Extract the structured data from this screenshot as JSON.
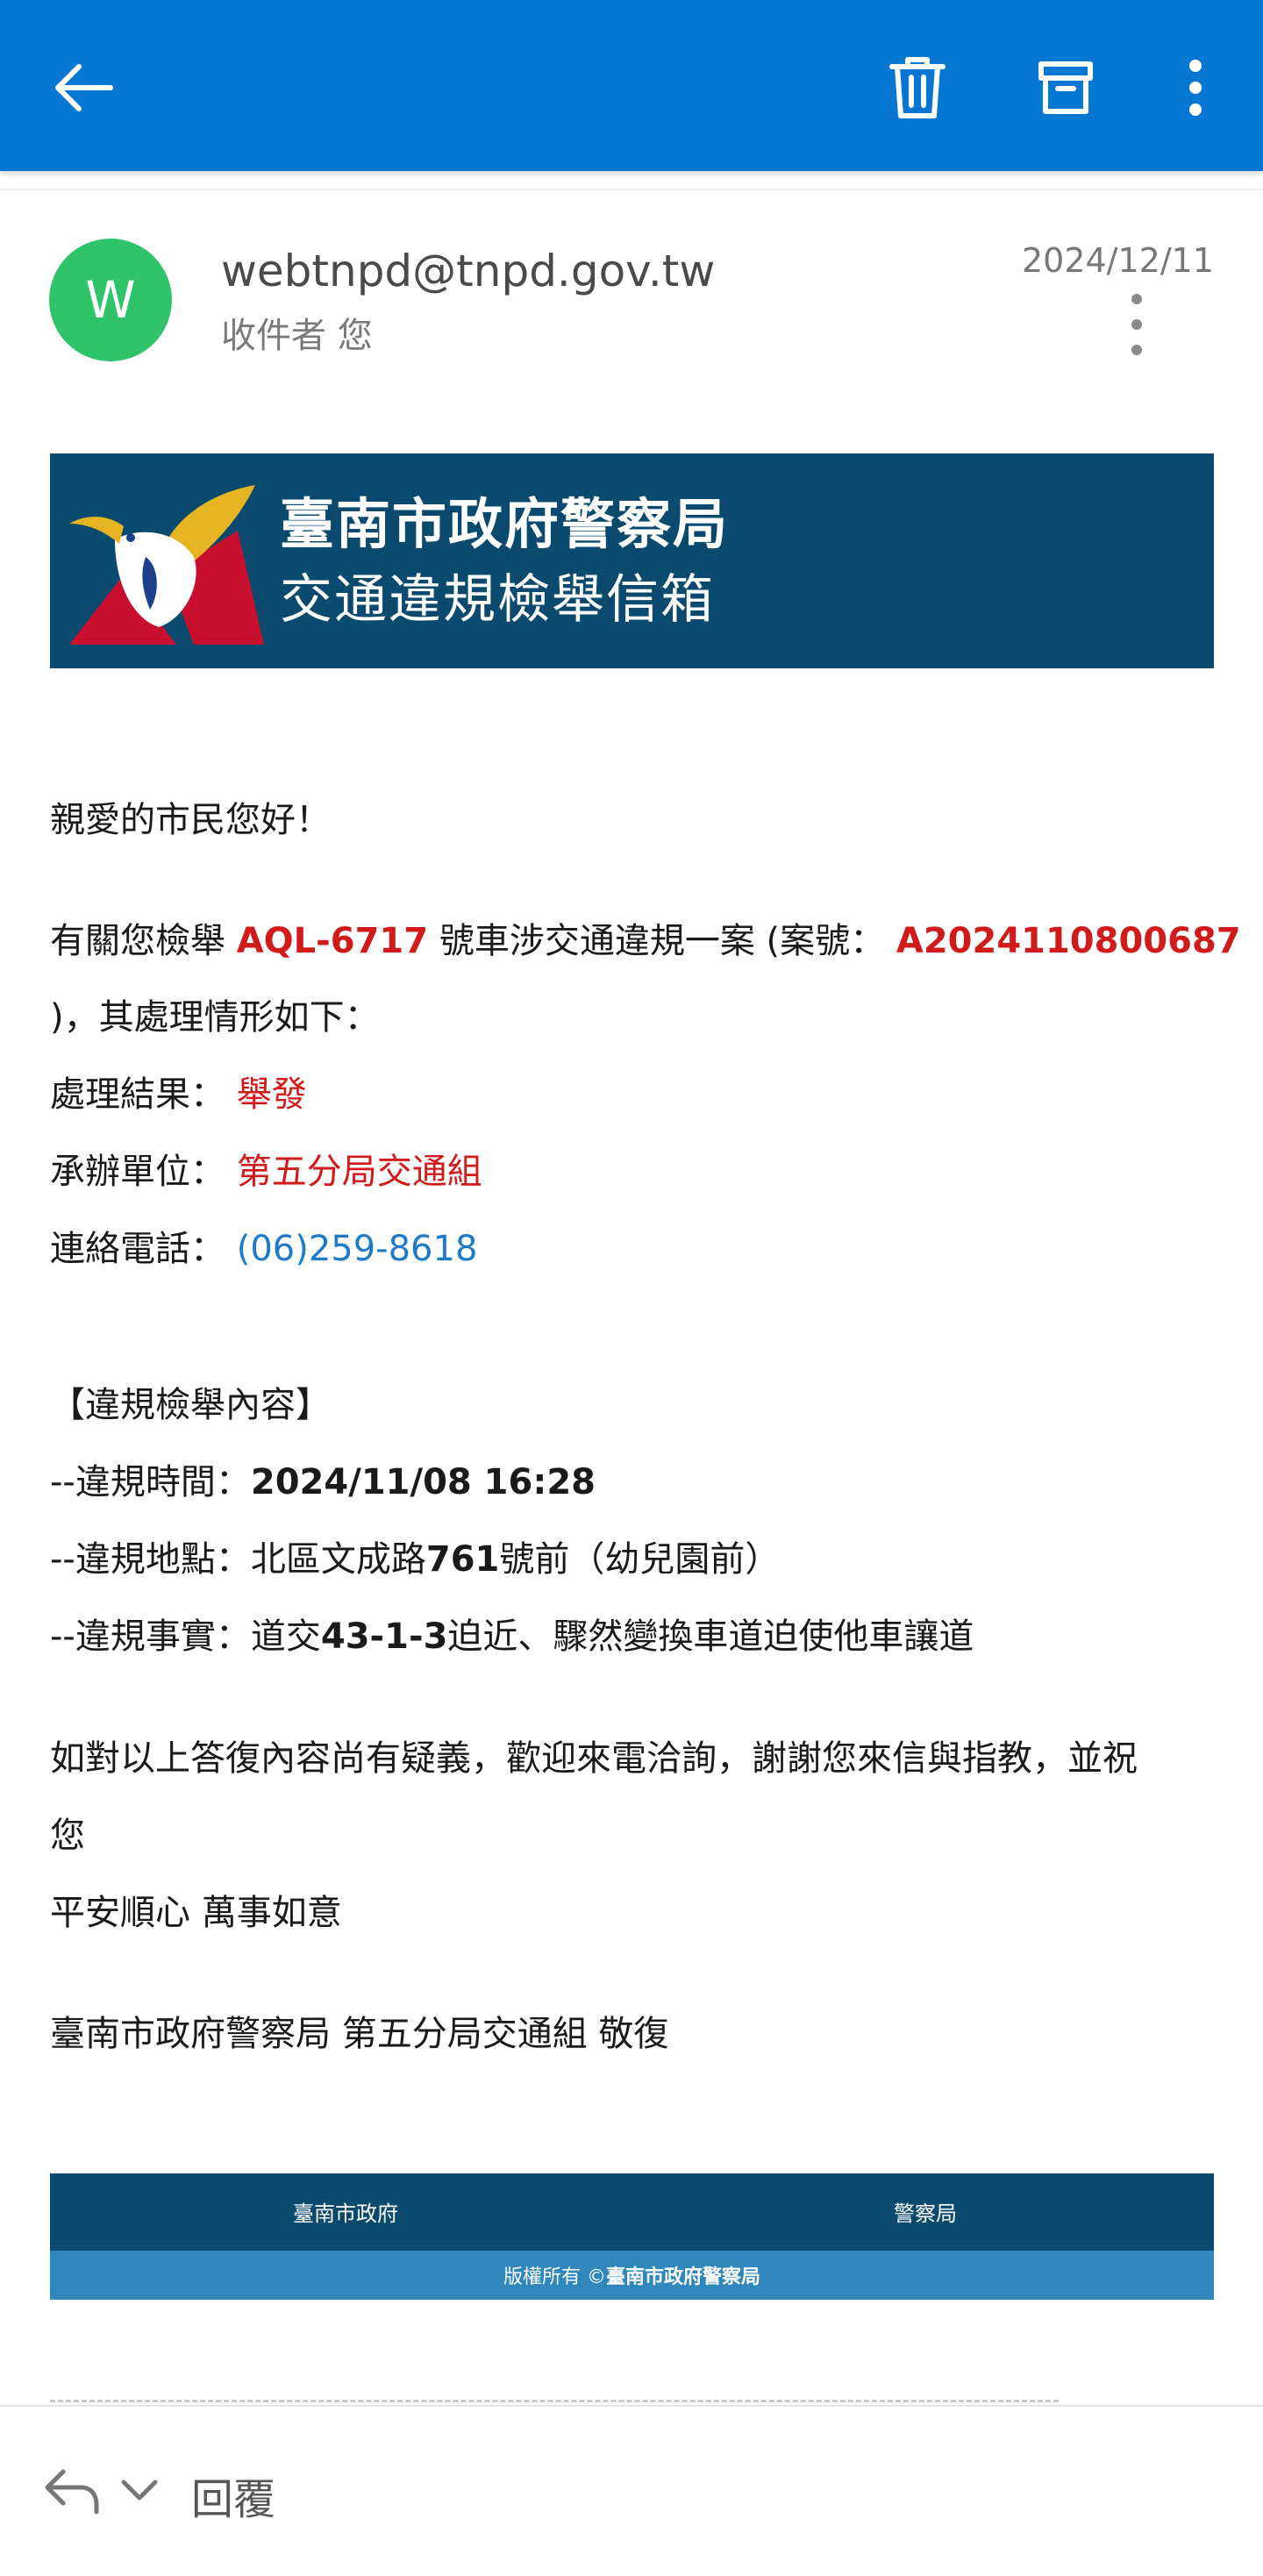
{
  "app_bar": {
    "icons": [
      "back-arrow-icon",
      "trash-icon",
      "archive-icon",
      "more-vert-icon"
    ],
    "color": "#0877d3"
  },
  "email": {
    "avatar_letter": "W",
    "avatar_color": "#2fc36a",
    "sender": "webtnpd@tnpd.gov.tw",
    "recipient": "收件者 您",
    "date": "2024/12/11"
  },
  "banner": {
    "title": "臺南市政府警察局",
    "subtitle": "交通違規檢舉信箱",
    "bg_color": "#0b4a6f"
  },
  "body": {
    "greeting": "親愛的市民您好！",
    "case_prefix": "有關您檢舉 ",
    "plate": "AQL-6717",
    "case_middle": " 號車涉交通違規一案 (案號： ",
    "case_no": "A2024110800687",
    "case_suffix": ")，其處理情形如下：",
    "result_label": "處理結果： ",
    "result_value": "舉發",
    "unit_label": "承辦單位： ",
    "unit_value": "第五分局交通組",
    "phone_label": "連絡電話： ",
    "phone_value": "(06)259-8618",
    "section_title": "【違規檢舉內容】",
    "time_label": "--違規時間：",
    "time_value": "2024/11/08 16:28",
    "place_a": "--違規地點：北區文成路",
    "place_num": "761",
    "place_b": "號前（幼兒園前）",
    "fact_a": "--違規事實：道交",
    "fact_num": "43-1-3",
    "fact_b": "迫近、驟然變換車道迫使他車讓道",
    "closing_1": "如對以上答復內容尚有疑義，歡迎來電洽詢，謝謝您來信與指教，並祝",
    "closing_2": "您",
    "closing_3": "平安順心 萬事如意",
    "signature": "臺南市政府警察局 第五分局交通組 敬復"
  },
  "footer": {
    "link_1": "臺南市政府",
    "link_2": "警察局",
    "copyright_prefix": "版權所有 © ",
    "copyright_org": "臺南市政府警察局"
  },
  "bottom_bar": {
    "reply_label": "回覆"
  }
}
